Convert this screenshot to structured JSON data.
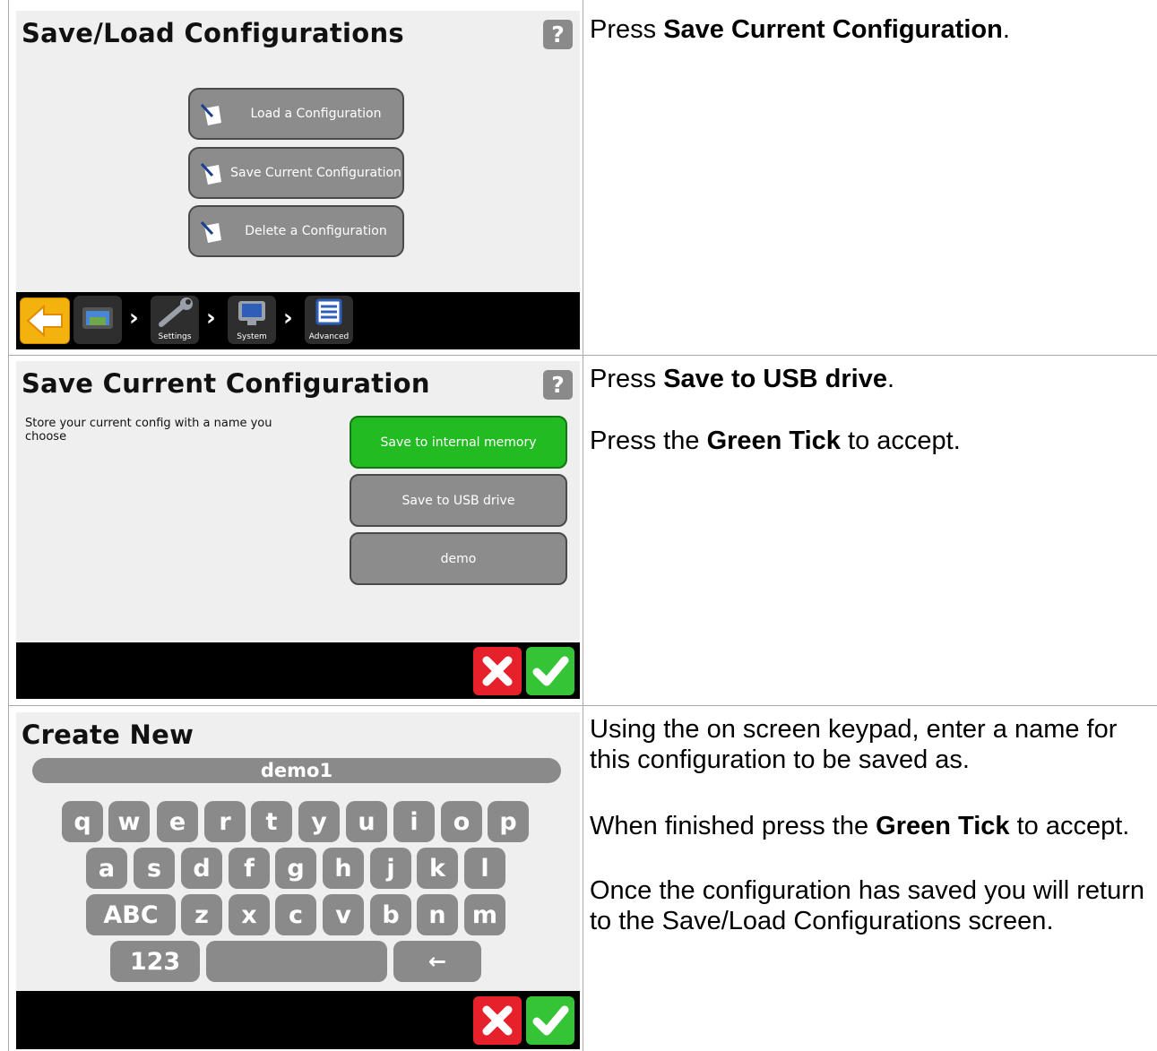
{
  "rows": [
    {
      "screen": {
        "title": "Save/Load Configurations",
        "help": "?",
        "buttons": [
          "Load a Configuration",
          "Save Current Configuration",
          "Delete a Configuration"
        ],
        "breadcrumb": [
          "Settings",
          "System",
          "Advanced"
        ]
      },
      "instruction": {
        "pre": "Press ",
        "bold": "Save Current Configuration",
        "post": "."
      }
    },
    {
      "screen": {
        "title": "Save Current Configuration",
        "help": "?",
        "hint": "Store your current config with a name you choose",
        "options": [
          "Save to internal memory",
          "Save to USB drive",
          "demo"
        ]
      },
      "instructions": [
        {
          "pre": "Press ",
          "bold": "Save to USB drive",
          "post": "."
        },
        {
          "pre": "Press the ",
          "bold": "Green Tick",
          "post": " to accept."
        }
      ]
    },
    {
      "screen": {
        "title": "Create New",
        "name_value": "demo1",
        "keys_row1": [
          "q",
          "w",
          "e",
          "r",
          "t",
          "y",
          "u",
          "i",
          "o",
          "p"
        ],
        "keys_row2": [
          "a",
          "s",
          "d",
          "f",
          "g",
          "h",
          "j",
          "k",
          "l"
        ],
        "keys_row3": [
          "ABC",
          "z",
          "x",
          "c",
          "v",
          "b",
          "n",
          "m"
        ],
        "key_123": "123",
        "key_backspace": "←"
      },
      "instructions": [
        {
          "text": "Using the on screen keypad, enter a name for this configuration to be saved as."
        },
        {
          "pre": "When finished press the ",
          "bold": "Green Tick",
          "post": " to accept."
        },
        {
          "text": "Once the configuration has saved you will return to the Save/Load Configurations screen."
        }
      ]
    }
  ],
  "icons": {
    "help": "question-mark-icon",
    "back": "back-arrow-icon",
    "cancel": "red-cross-icon",
    "accept": "green-tick-icon",
    "document": "document-pen-icon"
  },
  "colors": {
    "accept_green": "#35c435",
    "cancel_red": "#e6212b",
    "back_yellow": "#f3b20d",
    "selected_option": "#22bb22"
  }
}
